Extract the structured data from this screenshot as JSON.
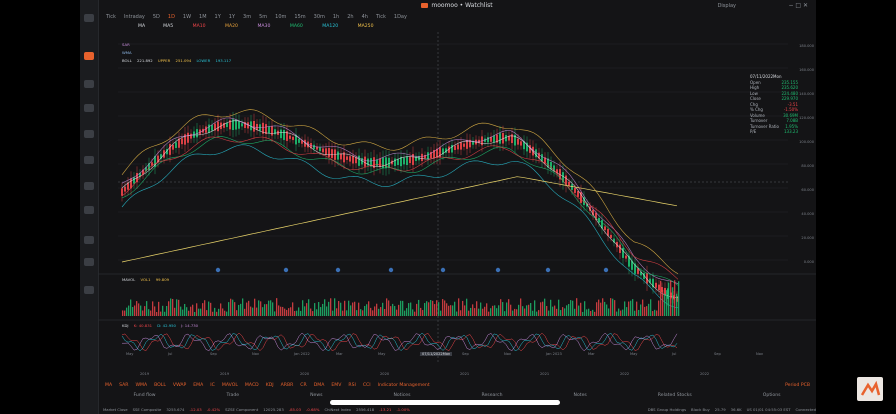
{
  "window": {
    "title": "moomoo • Watchlist",
    "display_label": "Display"
  },
  "toolbar": {
    "tabs": [
      "Tick",
      "Intraday",
      "5D",
      "1D",
      "1W",
      "1M",
      "1Y",
      "1Y",
      "3m",
      "5m",
      "10m",
      "15m",
      "30m",
      "1h",
      "2h",
      "4h",
      "Tick",
      "1Day"
    ],
    "selected_index": 3
  },
  "indicators": {
    "ma": [
      "MA",
      "MA5 ",
      "MA10 ",
      "MA20 ",
      "MA30 ",
      "MA60 ",
      "MA120 ",
      "MA250 "
    ],
    "row2": [
      "SAR",
      "MACD"
    ],
    "row3": [
      "WMA"
    ],
    "boll": {
      "label": "BOLL",
      "mid": "221.892",
      "upper_label": "UPPER",
      "upper": "251.094",
      "lower_label": "LOWER",
      "lower": "193.117"
    },
    "mavol": {
      "label": "MAVOL",
      "vol1": "VOL1",
      "vol1_value": "99.809"
    },
    "kdj": {
      "label": "KDJ",
      "k": "K: 40.831",
      "d": "D: 42.950",
      "j": "J: 14.730"
    }
  },
  "info_panel": {
    "date": "07/11/2022Mon",
    "rows": [
      {
        "label": "Open",
        "value": "235.155"
      },
      {
        "label": "High",
        "value": "235.620"
      },
      {
        "label": "Low",
        "value": "224.480"
      },
      {
        "label": "Close",
        "value": "229.970"
      },
      {
        "label": "Chg",
        "value": "-3.51"
      },
      {
        "label": "% Chg",
        "value": "-1.50%"
      },
      {
        "label": "Volume",
        "value": "30.69M"
      },
      {
        "label": "Turnover",
        "value": "7.08B"
      },
      {
        "label": "Turnover Ratio",
        "value": "1.95%"
      },
      {
        "label": "P/E",
        "value": "133.23"
      }
    ]
  },
  "y_axis": [
    "180.000",
    "160.000",
    "140.000",
    "120.000",
    "100.000",
    "80.000",
    "60.000",
    "40.000",
    "20.000",
    "0.000"
  ],
  "x_axis": [
    "May",
    "Jul",
    "Sep",
    "Nov",
    "Jan 2022",
    "Mar",
    "May",
    "Jul",
    "Sep",
    "Nov",
    "Jan 2023",
    "Mar",
    "May",
    "Jul",
    "Sep",
    "Nov"
  ],
  "year_axis": [
    "2019",
    "2019",
    "2020",
    "2020",
    "2021",
    "2021",
    "2022",
    "2022"
  ],
  "crosshair_date": "07/11/2022Mon",
  "bottom_tabs": {
    "items": [
      "MA",
      "SAR",
      "WMA",
      "BOLL",
      "VWAP",
      "EMA",
      "IC",
      "MAVOL",
      "MACD",
      "KDJ",
      "ARBR",
      "CR",
      "DMA",
      "EMV",
      "RSI",
      "CCI",
      "Indicator Management"
    ],
    "period": "Period PCB"
  },
  "nav": [
    "Fund flow",
    "Trade",
    "News",
    "Notices",
    "Research",
    "Notes",
    "Related Stocks",
    "Options"
  ],
  "status": {
    "market": "Market Close",
    "items": [
      "SSE Composite",
      "3255.674",
      "-12.03",
      "-0.42%",
      "SZSE Component",
      "12025.283",
      "-85.03",
      "-0.68%",
      "ChiNext Index",
      "2556.418",
      "-13.21",
      "-1.00%"
    ],
    "right": [
      "DBS Group Holdings",
      "Block Buy",
      "25.79",
      "36.6K",
      "US 01/01 04:55:03 EST",
      "Connected"
    ]
  },
  "colors": {
    "accent": "#e8622d",
    "up": "#1fbf72",
    "down": "#f0454a",
    "bg": "#141416"
  }
}
